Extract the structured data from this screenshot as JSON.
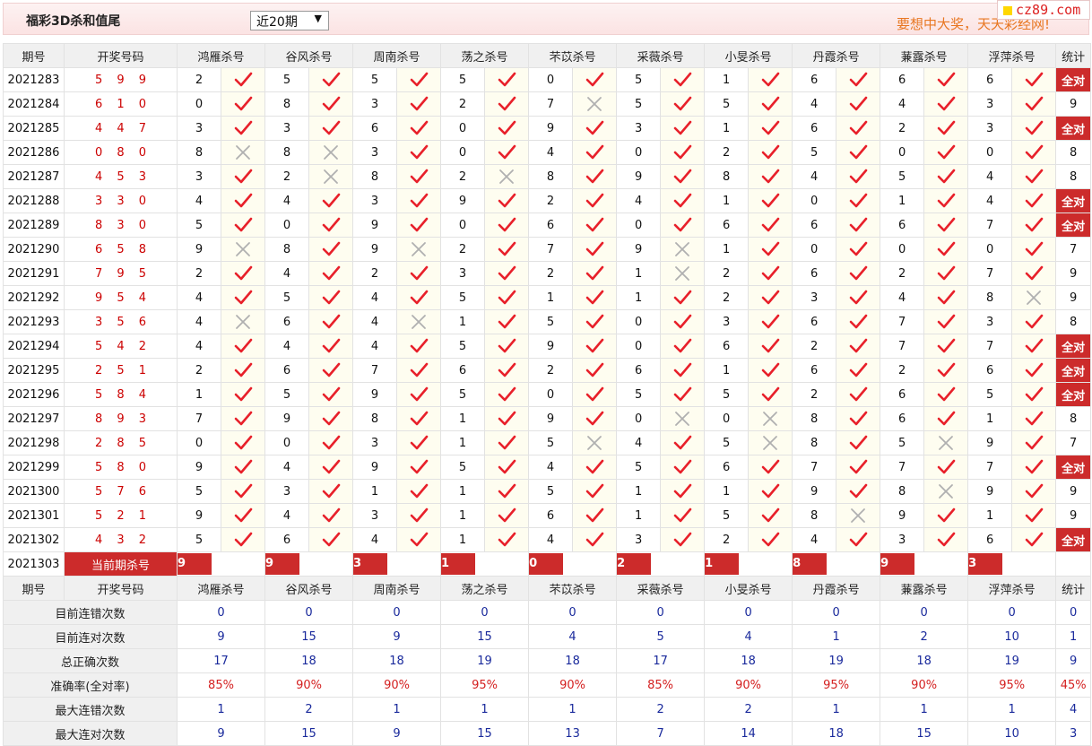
{
  "header": {
    "title": "福彩3D杀和值尾",
    "period_select": "近20期",
    "slogan": "要想中大奖，天天彩经网!",
    "logo_text": "cz89.com"
  },
  "columns": {
    "issue": "期号",
    "numbers": "开奖号码",
    "experts": [
      "鸿雁杀号",
      "谷风杀号",
      "周南杀号",
      "荡之杀号",
      "芣苡杀号",
      "采薇杀号",
      "小旻杀号",
      "丹霞杀号",
      "蒹露杀号",
      "浮萍杀号"
    ],
    "stat": "统计"
  },
  "rows": [
    {
      "issue": "2021283",
      "numbers": "5 9 9",
      "kills": [
        2,
        5,
        5,
        5,
        0,
        5,
        1,
        6,
        6,
        6
      ],
      "hits": [
        1,
        1,
        1,
        1,
        1,
        1,
        1,
        1,
        1,
        1
      ],
      "stat": "全对"
    },
    {
      "issue": "2021284",
      "numbers": "6 1 0",
      "kills": [
        0,
        8,
        3,
        2,
        7,
        5,
        5,
        4,
        4,
        3
      ],
      "hits": [
        1,
        1,
        1,
        1,
        0,
        1,
        1,
        1,
        1,
        1
      ],
      "stat": "9"
    },
    {
      "issue": "2021285",
      "numbers": "4 4 7",
      "kills": [
        3,
        3,
        6,
        0,
        9,
        3,
        1,
        6,
        2,
        3
      ],
      "hits": [
        1,
        1,
        1,
        1,
        1,
        1,
        1,
        1,
        1,
        1
      ],
      "stat": "全对"
    },
    {
      "issue": "2021286",
      "numbers": "0 8 0",
      "kills": [
        8,
        8,
        3,
        0,
        4,
        0,
        2,
        5,
        0,
        0
      ],
      "hits": [
        0,
        0,
        1,
        1,
        1,
        1,
        1,
        1,
        1,
        1
      ],
      "stat": "8"
    },
    {
      "issue": "2021287",
      "numbers": "4 5 3",
      "kills": [
        3,
        2,
        8,
        2,
        8,
        9,
        8,
        4,
        5,
        4
      ],
      "hits": [
        1,
        0,
        1,
        0,
        1,
        1,
        1,
        1,
        1,
        1
      ],
      "stat": "8"
    },
    {
      "issue": "2021288",
      "numbers": "3 3 0",
      "kills": [
        4,
        4,
        3,
        9,
        2,
        4,
        1,
        0,
        1,
        4
      ],
      "hits": [
        1,
        1,
        1,
        1,
        1,
        1,
        1,
        1,
        1,
        1
      ],
      "stat": "全对"
    },
    {
      "issue": "2021289",
      "numbers": "8 3 0",
      "kills": [
        5,
        0,
        9,
        0,
        6,
        0,
        6,
        6,
        6,
        7
      ],
      "hits": [
        1,
        1,
        1,
        1,
        1,
        1,
        1,
        1,
        1,
        1
      ],
      "stat": "全对"
    },
    {
      "issue": "2021290",
      "numbers": "6 5 8",
      "kills": [
        9,
        8,
        9,
        2,
        7,
        9,
        1,
        0,
        0,
        0
      ],
      "hits": [
        0,
        1,
        0,
        1,
        1,
        0,
        1,
        1,
        1,
        1
      ],
      "stat": "7"
    },
    {
      "issue": "2021291",
      "numbers": "7 9 5",
      "kills": [
        2,
        4,
        2,
        3,
        2,
        1,
        2,
        6,
        2,
        7
      ],
      "hits": [
        1,
        1,
        1,
        1,
        1,
        0,
        1,
        1,
        1,
        1
      ],
      "stat": "9"
    },
    {
      "issue": "2021292",
      "numbers": "9 5 4",
      "kills": [
        4,
        5,
        4,
        5,
        1,
        1,
        2,
        3,
        4,
        8
      ],
      "hits": [
        1,
        1,
        1,
        1,
        1,
        1,
        1,
        1,
        1,
        0
      ],
      "stat": "9"
    },
    {
      "issue": "2021293",
      "numbers": "3 5 6",
      "kills": [
        4,
        6,
        4,
        1,
        5,
        0,
        3,
        6,
        7,
        3
      ],
      "hits": [
        0,
        1,
        0,
        1,
        1,
        1,
        1,
        1,
        1,
        1
      ],
      "stat": "8"
    },
    {
      "issue": "2021294",
      "numbers": "5 4 2",
      "kills": [
        4,
        4,
        4,
        5,
        9,
        0,
        6,
        2,
        7,
        7
      ],
      "hits": [
        1,
        1,
        1,
        1,
        1,
        1,
        1,
        1,
        1,
        1
      ],
      "stat": "全对"
    },
    {
      "issue": "2021295",
      "numbers": "2 5 1",
      "kills": [
        2,
        6,
        7,
        6,
        2,
        6,
        1,
        6,
        2,
        6
      ],
      "hits": [
        1,
        1,
        1,
        1,
        1,
        1,
        1,
        1,
        1,
        1
      ],
      "stat": "全对"
    },
    {
      "issue": "2021296",
      "numbers": "5 8 4",
      "kills": [
        1,
        5,
        9,
        5,
        0,
        5,
        5,
        2,
        6,
        5
      ],
      "hits": [
        1,
        1,
        1,
        1,
        1,
        1,
        1,
        1,
        1,
        1
      ],
      "stat": "全对"
    },
    {
      "issue": "2021297",
      "numbers": "8 9 3",
      "kills": [
        7,
        9,
        8,
        1,
        9,
        0,
        0,
        8,
        6,
        1
      ],
      "hits": [
        1,
        1,
        1,
        1,
        1,
        0,
        0,
        1,
        1,
        1
      ],
      "stat": "8"
    },
    {
      "issue": "2021298",
      "numbers": "2 8 5",
      "kills": [
        0,
        0,
        3,
        1,
        5,
        4,
        5,
        8,
        5,
        9
      ],
      "hits": [
        1,
        1,
        1,
        1,
        0,
        1,
        0,
        1,
        0,
        1
      ],
      "stat": "7"
    },
    {
      "issue": "2021299",
      "numbers": "5 8 0",
      "kills": [
        9,
        4,
        9,
        5,
        4,
        5,
        6,
        7,
        7,
        7
      ],
      "hits": [
        1,
        1,
        1,
        1,
        1,
        1,
        1,
        1,
        1,
        1
      ],
      "stat": "全对"
    },
    {
      "issue": "2021300",
      "numbers": "5 7 6",
      "kills": [
        5,
        3,
        1,
        1,
        5,
        1,
        1,
        9,
        8,
        9
      ],
      "hits": [
        1,
        1,
        1,
        1,
        1,
        1,
        1,
        1,
        0,
        1
      ],
      "stat": "9"
    },
    {
      "issue": "2021301",
      "numbers": "5 2 1",
      "kills": [
        9,
        4,
        3,
        1,
        6,
        1,
        5,
        8,
        9,
        1
      ],
      "hits": [
        1,
        1,
        1,
        1,
        1,
        1,
        1,
        0,
        1,
        1
      ],
      "stat": "9"
    },
    {
      "issue": "2021302",
      "numbers": "4 3 2",
      "kills": [
        5,
        6,
        4,
        1,
        4,
        3,
        2,
        4,
        3,
        6
      ],
      "hits": [
        1,
        1,
        1,
        1,
        1,
        1,
        1,
        1,
        1,
        1
      ],
      "stat": "全对"
    }
  ],
  "current": {
    "issue": "2021303",
    "label": "当前期杀号",
    "kills": [
      9,
      9,
      3,
      1,
      0,
      2,
      1,
      8,
      9,
      3
    ]
  },
  "summary": {
    "header_issue": "期号",
    "header_numbers": "开奖号码",
    "rows": [
      {
        "label": "目前连错次数",
        "values": [
          "0",
          "0",
          "0",
          "0",
          "0",
          "0",
          "0",
          "0",
          "0",
          "0"
        ],
        "stat": "0",
        "red": false
      },
      {
        "label": "目前连对次数",
        "values": [
          "9",
          "15",
          "9",
          "15",
          "4",
          "5",
          "4",
          "1",
          "2",
          "10"
        ],
        "stat": "1",
        "red": false
      },
      {
        "label": "总正确次数",
        "values": [
          "17",
          "18",
          "18",
          "19",
          "18",
          "17",
          "18",
          "19",
          "18",
          "19"
        ],
        "stat": "9",
        "red": false
      },
      {
        "label": "准确率(全对率)",
        "values": [
          "85%",
          "90%",
          "90%",
          "95%",
          "90%",
          "85%",
          "90%",
          "95%",
          "90%",
          "95%"
        ],
        "stat": "45%",
        "red": true
      },
      {
        "label": "最大连错次数",
        "values": [
          "1",
          "2",
          "1",
          "1",
          "1",
          "2",
          "2",
          "1",
          "1",
          "1"
        ],
        "stat": "4",
        "red": false
      },
      {
        "label": "最大连对次数",
        "values": [
          "9",
          "15",
          "9",
          "15",
          "13",
          "7",
          "14",
          "18",
          "15",
          "10"
        ],
        "stat": "3",
        "red": false
      }
    ]
  },
  "colors": {
    "accent_red": "#cc2b2b",
    "check_red": "#e8202a",
    "cross_gray": "#b0b0b0",
    "summary_blue": "#1a2a9c",
    "slogan_orange": "#e87722"
  }
}
